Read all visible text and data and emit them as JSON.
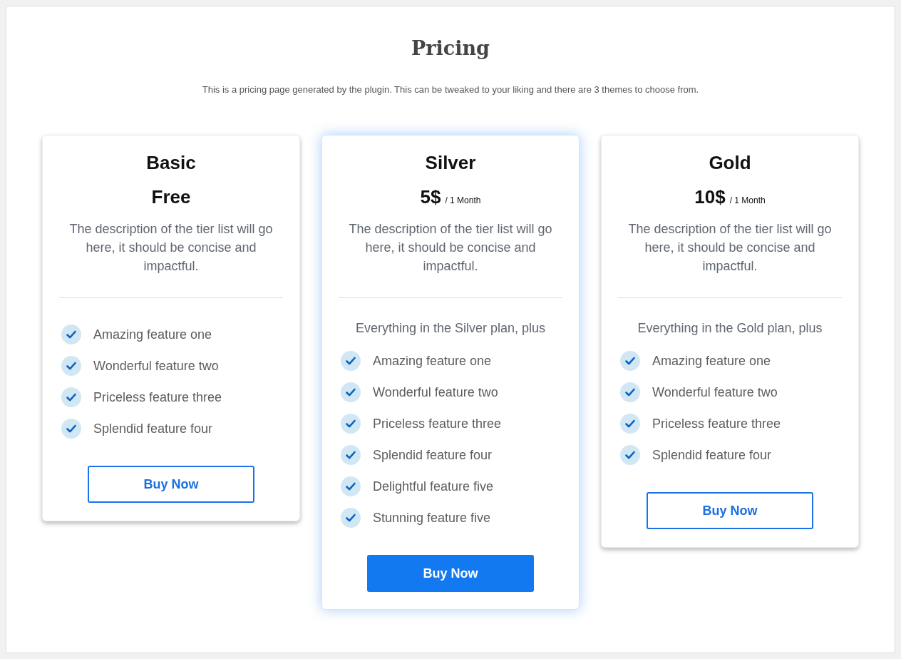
{
  "header": {
    "title": "Pricing",
    "subtitle": "This is a pricing page generated by the plugin. This can be tweaked to your liking and there are 3 themes to choose from."
  },
  "plans": [
    {
      "name": "Basic",
      "price": "Free",
      "featured": false,
      "description": "The description of the tier list will go here, it should be concise and impactful.",
      "features": [
        "Amazing feature one",
        "Wonderful feature two",
        "Priceless feature three",
        "Splendid feature four"
      ],
      "button": "Buy Now"
    },
    {
      "name": "Silver",
      "price": "5$",
      "period": "/ 1 Month",
      "featured": true,
      "description": "The description of the tier list will go here, it should be concise and impactful.",
      "features_heading": "Everything in the Silver plan, plus",
      "features": [
        "Amazing feature one",
        "Wonderful feature two",
        "Priceless feature three",
        "Splendid feature four",
        "Delightful feature five",
        "Stunning feature five"
      ],
      "button": "Buy Now"
    },
    {
      "name": "Gold",
      "price": "10$",
      "period": "/ 1 Month",
      "featured": false,
      "description": "The description of the tier list will go here, it should be concise and impactful.",
      "features_heading": "Everything in the Gold plan, plus",
      "features": [
        "Amazing feature one",
        "Wonderful feature two",
        "Priceless feature three",
        "Splendid feature four"
      ],
      "button": "Buy Now"
    }
  ]
}
